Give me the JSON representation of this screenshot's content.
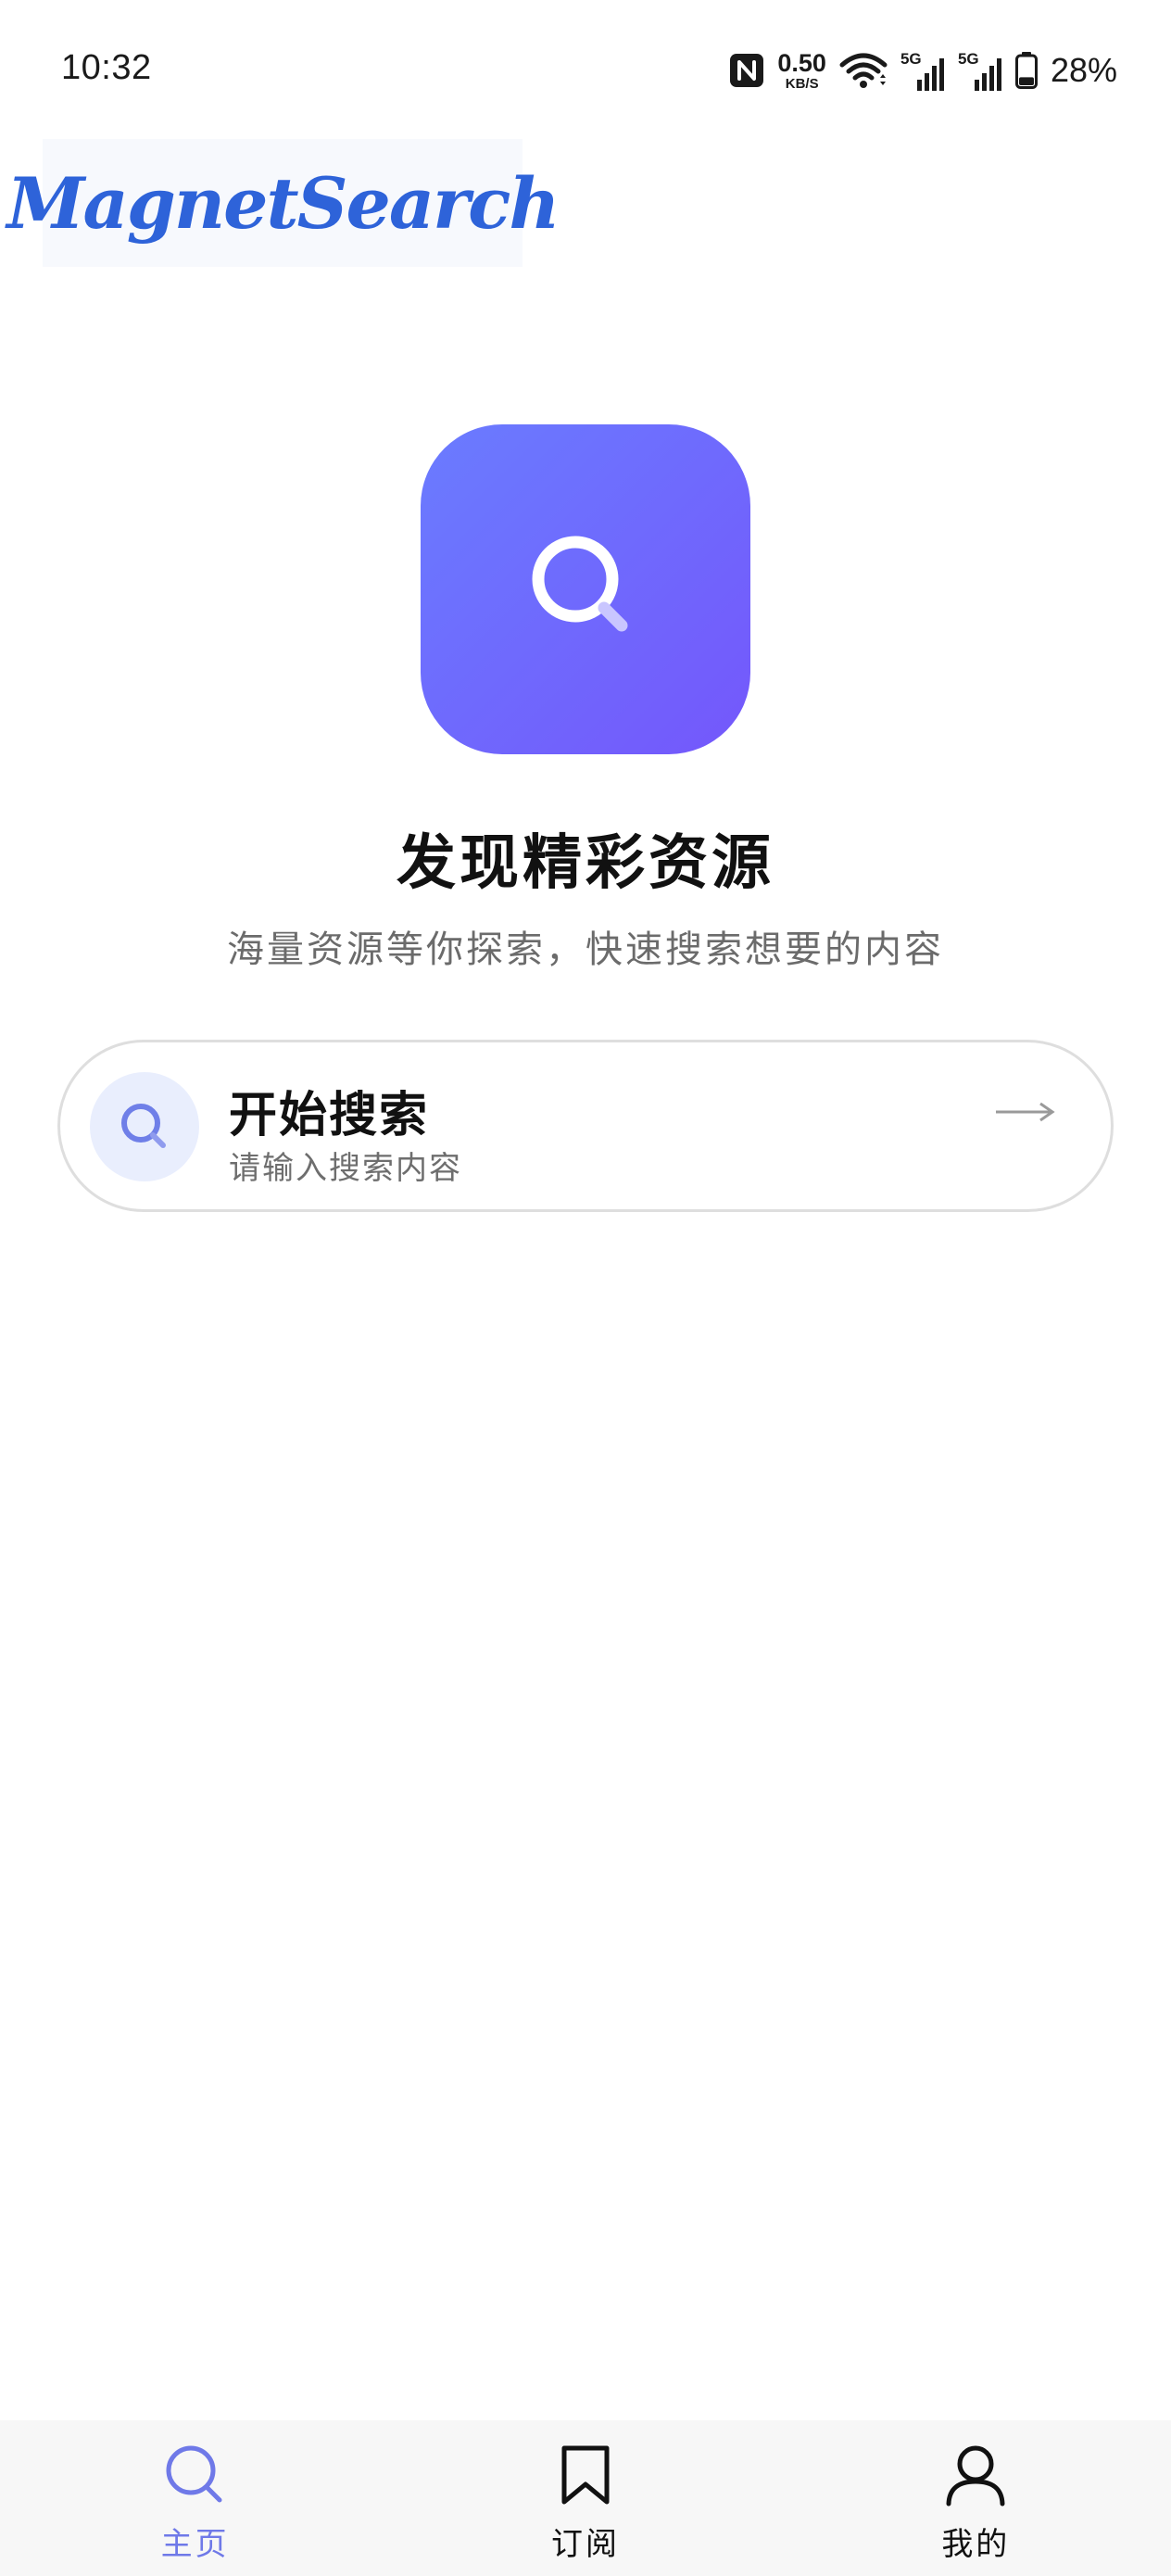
{
  "status_bar": {
    "time": "10:32",
    "net_speed_value": "0.50",
    "net_speed_unit": "KB/S",
    "sim1_tag": "5G",
    "sim2_tag": "5G",
    "battery_percent": "28%",
    "battery_level": 0.28
  },
  "app": {
    "logo_text": "MagnetSearch",
    "brand_color": "#2e63d9",
    "accent_gradient": [
      "#6a7cff",
      "#7457fb"
    ]
  },
  "hero": {
    "icon": "search-icon",
    "title": "发现精彩资源",
    "subtitle": "海量资源等你探索，快速搜索想要的内容"
  },
  "search_card": {
    "icon": "search-icon",
    "title": "开始搜索",
    "placeholder": "请输入搜索内容",
    "arrow": "→"
  },
  "bottom_nav": {
    "active_color": "#6f79e8",
    "items": [
      {
        "label": "主页",
        "icon": "search-icon",
        "active": true
      },
      {
        "label": "订阅",
        "icon": "bookmark-icon",
        "active": false
      },
      {
        "label": "我的",
        "icon": "user-icon",
        "active": false
      }
    ]
  }
}
